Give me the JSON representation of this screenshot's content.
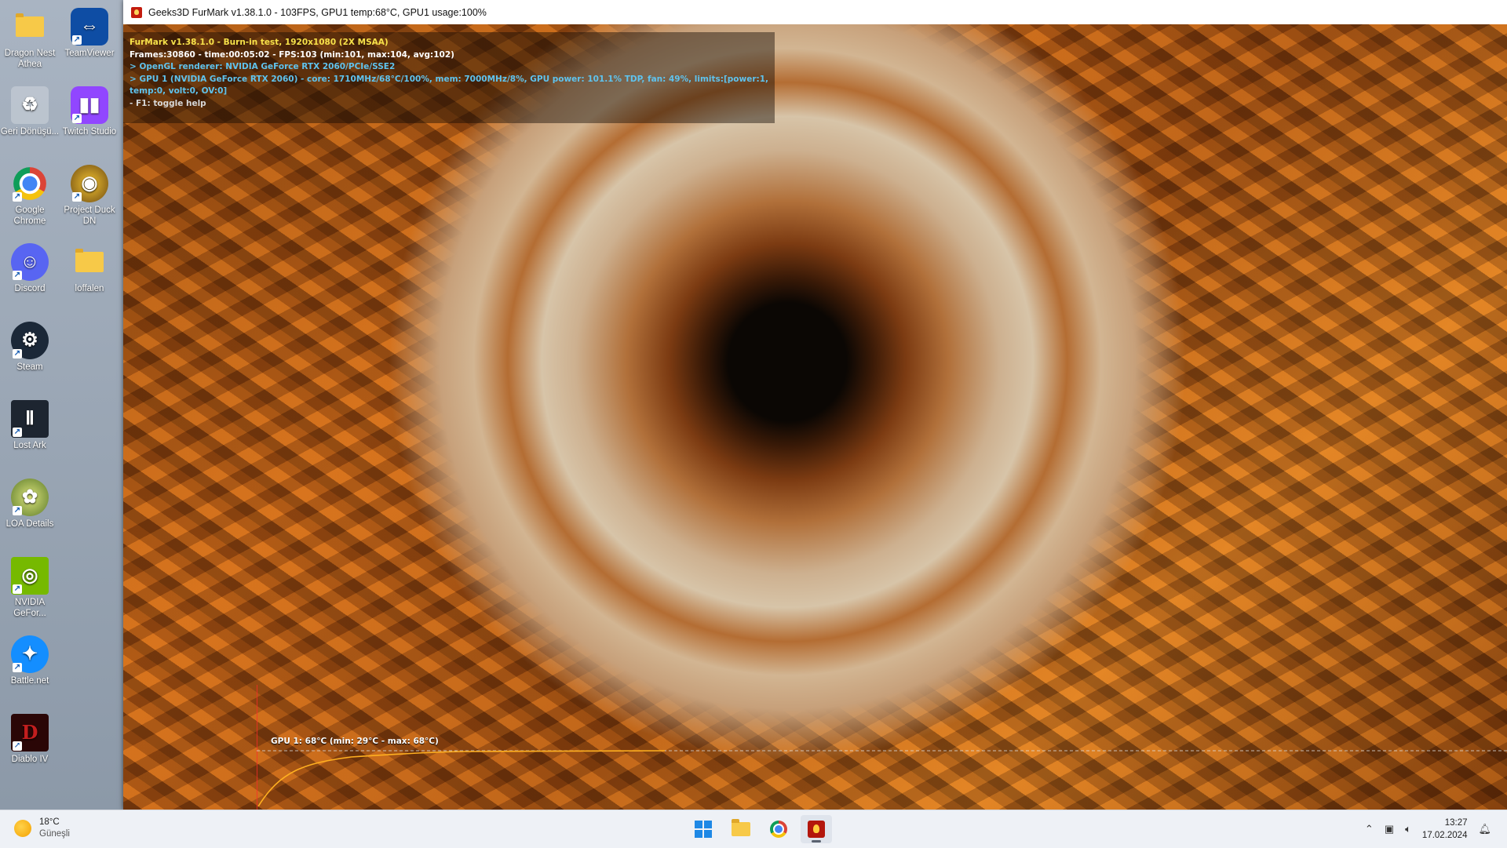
{
  "window": {
    "title": "Geeks3D FurMark v1.38.1.0 - 103FPS, GPU1 temp:68°C, GPU1 usage:100%"
  },
  "hud": {
    "line1": "FurMark v1.38.1.0 - Burn-in test, 1920x1080 (2X MSAA)",
    "line2": "Frames:30860 - time:00:05:02 - FPS:103 (min:101, max:104, avg:102)",
    "line3": "> OpenGL renderer: NVIDIA GeForce RTX 2060/PCIe/SSE2",
    "line4": "> GPU 1 (NVIDIA GeForce RTX 2060) - core: 1710MHz/68°C/100%, mem: 7000MHz/8%, GPU power: 101.1% TDP, fan: 49%, limits:[power:1, temp:0, volt:0, OV:0]",
    "line5": "- F1: toggle help"
  },
  "graph": {
    "label": "GPU 1: 68°C (min: 29°C - max: 68°C)",
    "current_temp_c": 68,
    "min_temp_c": 29,
    "max_temp_c": 68
  },
  "desktop_icons": [
    {
      "label": "Dragon Nest Athea",
      "icon": "folder-icon"
    },
    {
      "label": "TeamViewer",
      "icon": "teamviewer-icon"
    },
    {
      "label": "Geri Dönüşü...",
      "icon": "recycle-bin-icon"
    },
    {
      "label": "Twitch Studio",
      "icon": "twitch-icon"
    },
    {
      "label": "Google Chrome",
      "icon": "chrome-icon"
    },
    {
      "label": "Project Duck DN",
      "icon": "duck-icon"
    },
    {
      "label": "Discord",
      "icon": "discord-icon"
    },
    {
      "label": "loffalen",
      "icon": "folder-icon"
    },
    {
      "label": "Steam",
      "icon": "steam-icon"
    },
    {
      "label": "Lost Ark",
      "icon": "lost-ark-icon"
    },
    {
      "label": "LOA Details",
      "icon": "loa-details-icon"
    },
    {
      "label": "NVIDIA GeFor...",
      "icon": "nvidia-icon"
    },
    {
      "label": "Battle.net",
      "icon": "battlenet-icon"
    },
    {
      "label": "Diablo IV",
      "icon": "diablo-icon"
    }
  ],
  "taskbar": {
    "weather_temp": "18°C",
    "weather_cond": "Güneşli",
    "time": "13:27",
    "date": "17.02.2024"
  }
}
